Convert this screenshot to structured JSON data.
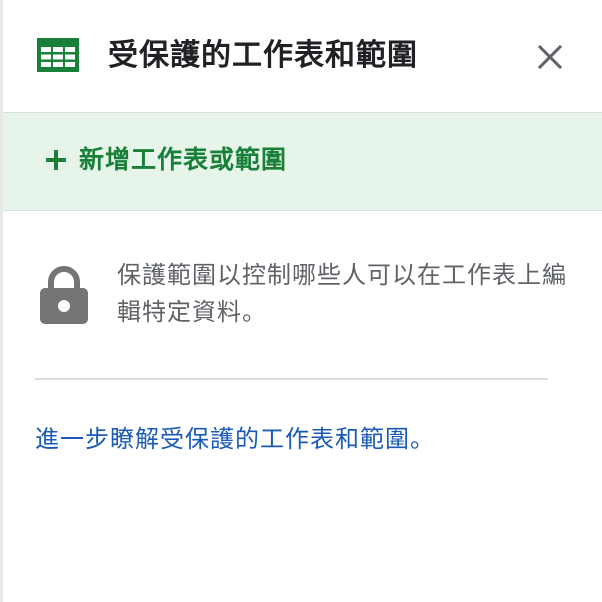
{
  "header": {
    "title": "受保護的工作表和範圍",
    "icon": "sheets-icon",
    "close_icon": "close-icon"
  },
  "add_range": {
    "label": "新增工作表或範圍",
    "icon": "plus-icon"
  },
  "info": {
    "icon": "lock-icon",
    "text": "保護範圍以控制哪些人可以在工作表上編輯特定資料。"
  },
  "learn_more": {
    "label": "進一步瞭解受保護的工作表和範圍。"
  },
  "colors": {
    "accent_green": "#188038",
    "add_bar_bg": "#e6f4ea",
    "link_blue": "#1a5bb8",
    "text_gray": "#5f6368",
    "icon_gray": "#757575"
  }
}
